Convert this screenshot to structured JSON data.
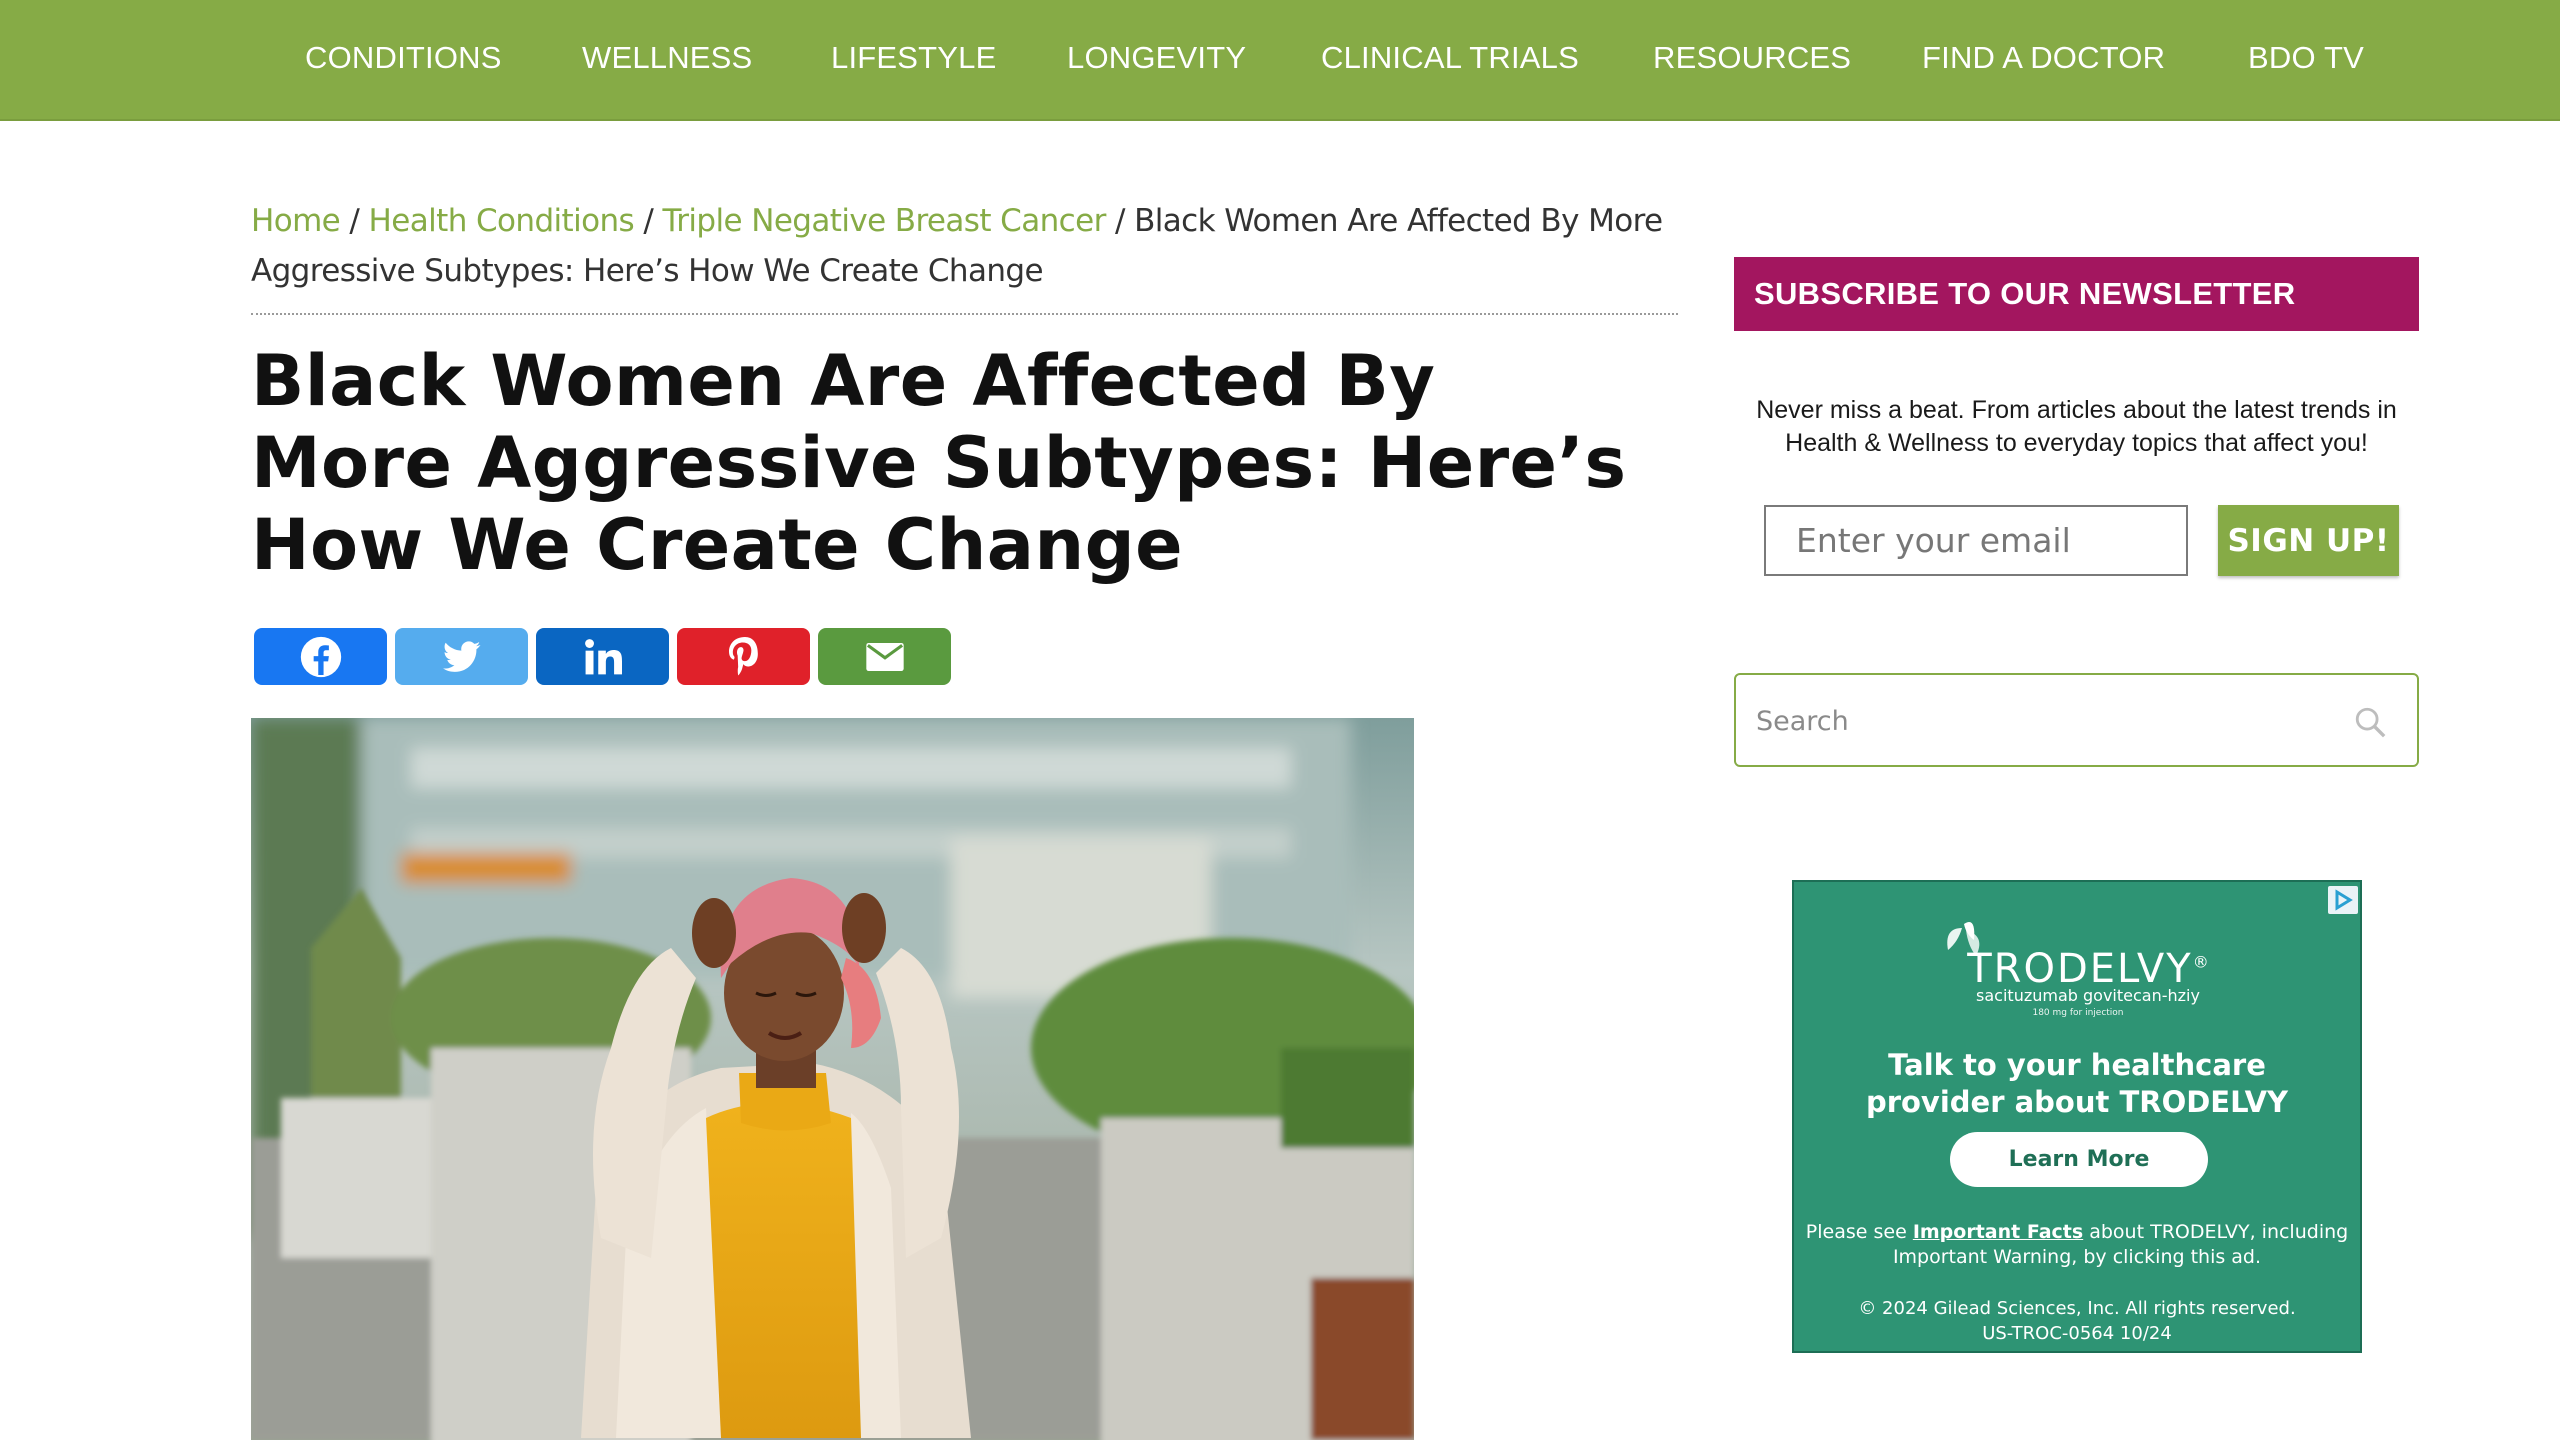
{
  "nav": {
    "items": [
      {
        "label": "CONDITIONS"
      },
      {
        "label": "WELLNESS"
      },
      {
        "label": "LIFESTYLE"
      },
      {
        "label": "LONGEVITY"
      },
      {
        "label": "CLINICAL TRIALS"
      },
      {
        "label": "RESOURCES"
      },
      {
        "label": "FIND A DOCTOR"
      },
      {
        "label": "BDO TV"
      }
    ]
  },
  "breadcrumb": {
    "home": "Home",
    "sep": "/",
    "health_conditions": "Health Conditions",
    "tnbc": "Triple Negative Breast Cancer",
    "current": "Black Women Are Affected By More Aggressive Subtypes: Here’s How We Create Change"
  },
  "article": {
    "title": "Black Women Are Affected By More Aggressive Subtypes: Here’s How We Create Change"
  },
  "share": [
    {
      "network": "facebook",
      "icon": "facebook-icon",
      "color": "#1877f2"
    },
    {
      "network": "twitter",
      "icon": "twitter-icon",
      "color": "#55acee"
    },
    {
      "network": "linkedin",
      "icon": "linkedin-icon",
      "color": "#0a66c2"
    },
    {
      "network": "pinterest",
      "icon": "pinterest-icon",
      "color": "#e0212a"
    },
    {
      "network": "email",
      "icon": "email-icon",
      "color": "#5a9a3f"
    }
  ],
  "newsletter": {
    "heading": "SUBSCRIBE TO OUR NEWSLETTER",
    "text": "Never miss a beat. From articles about the latest trends in Health & Wellness to everyday topics that affect you!",
    "email_placeholder": "Enter your email",
    "button": "SIGN UP!"
  },
  "search": {
    "placeholder": "Search",
    "icon": "search-icon"
  },
  "ad": {
    "brand": "TRODELVY",
    "brand_mark": "®",
    "generic": "sacituzumab govitecan-hziy",
    "dose": "180 mg for injection",
    "headline": "Talk to your healthcare provider about TRODELVY",
    "cta": "Learn More",
    "note_prefix": "Please see ",
    "note_link": "Important Facts",
    "note_suffix": " about TRODELVY, including Important Warning, by clicking this ad.",
    "copyright": "© 2024 Gilead Sciences, Inc. All rights reserved.",
    "code": "US-TROC-0564 10/24"
  },
  "colors": {
    "nav_green": "#86ab46",
    "link_green": "#86ab46",
    "newsletter_magenta": "#a3165f",
    "ad_teal": "#2e9474"
  }
}
